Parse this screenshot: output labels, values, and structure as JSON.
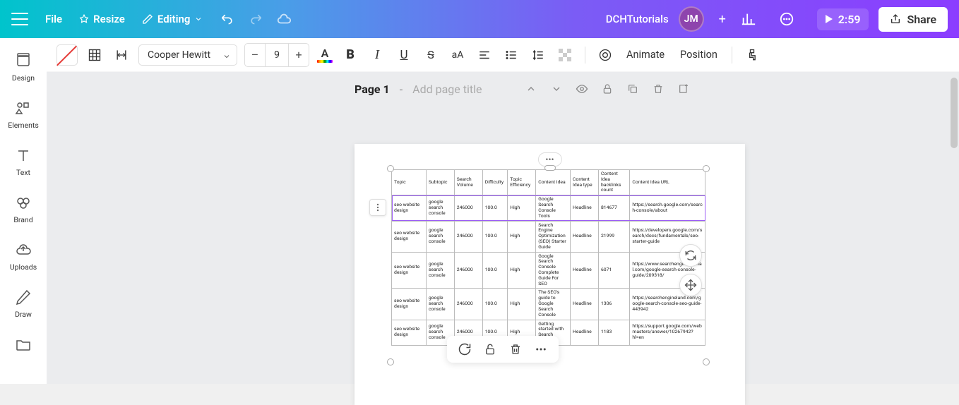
{
  "topbar": {
    "file": "File",
    "resize": "Resize",
    "editing": "Editing",
    "username": "DCHTutorials",
    "avatar": "JM",
    "timer": "2:59",
    "share": "Share"
  },
  "sidebar": {
    "items": [
      {
        "label": "Design"
      },
      {
        "label": "Elements"
      },
      {
        "label": "Text"
      },
      {
        "label": "Brand"
      },
      {
        "label": "Uploads"
      },
      {
        "label": "Draw"
      }
    ]
  },
  "toolbar": {
    "font": "Cooper Hewitt",
    "minus": "–",
    "size": "9",
    "plus": "+",
    "animate": "Animate",
    "position": "Position"
  },
  "page": {
    "label": "Page 1",
    "dash": "-",
    "placeholder": "Add page title"
  },
  "table": {
    "headers": [
      "Topic",
      "Subtopic",
      "Search Volume",
      "Difficulty",
      "Topic Efficiency",
      "Content Idea",
      "Content Idea type",
      "Content Idea backlinks count",
      "Content Idea URL"
    ],
    "rows": [
      [
        "seo website design",
        "google search console",
        "246000",
        "100.0",
        "High",
        "Google Search Console Tools",
        "Headline",
        "814677",
        "https://search.google.com/search-console/about"
      ],
      [
        "seo website design",
        "google search console",
        "246000",
        "100.0",
        "High",
        "Search Engine Optimization (SEO) Starter Guide",
        "Headline",
        "21999",
        "https://developers.google.com/search/docs/fundamentals/seo-starter-guide"
      ],
      [
        "seo website design",
        "google search console",
        "246000",
        "100.0",
        "High",
        "Google Search Console Complete Guide For SEO",
        "Headline",
        "6071",
        "https://www.searchenginejournal.com/google-search-console-guide/209318/"
      ],
      [
        "seo website design",
        "google search console",
        "246000",
        "100.0",
        "High",
        "The SEO's guide to Google Search Console",
        "Headline",
        "1306",
        "https://searchengineland.com/google-search-console-seo-guide-443942"
      ],
      [
        "seo website design",
        "google search console",
        "246000",
        "100.0",
        "High",
        "Getting started with Search Console",
        "Headline",
        "1183",
        "https://support.google.com/webmasters/answer/10267942?hl=en"
      ]
    ]
  }
}
